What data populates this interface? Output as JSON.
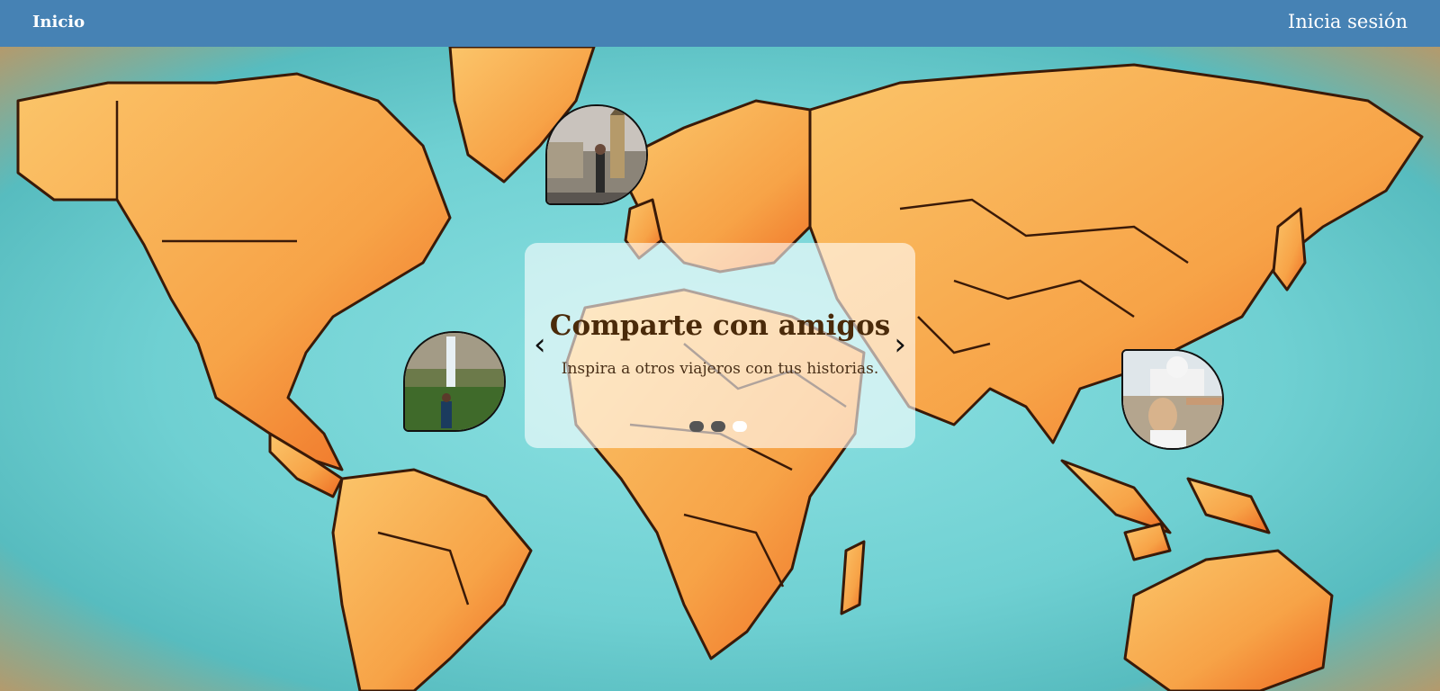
{
  "nav": {
    "home_label": "Inicio",
    "login_label": "Inicia sesión"
  },
  "carousel": {
    "title": "Comparte con amigos",
    "subtitle": "Inspira a otros viajeros con tus historias.",
    "prev_icon": "‹",
    "next_icon": "›",
    "slides_count": 3,
    "active_slide": 3
  },
  "photos": [
    {
      "icon": "photo-london-big-ben"
    },
    {
      "icon": "photo-waterfall"
    },
    {
      "icon": "photo-taj-mahal"
    }
  ],
  "colors": {
    "header": "#4682b4",
    "ocean": "#6fd0d2",
    "land": "#f7a347",
    "land_light": "#fbc56a",
    "border": "#3a1a08",
    "title": "#4a2a0a"
  }
}
